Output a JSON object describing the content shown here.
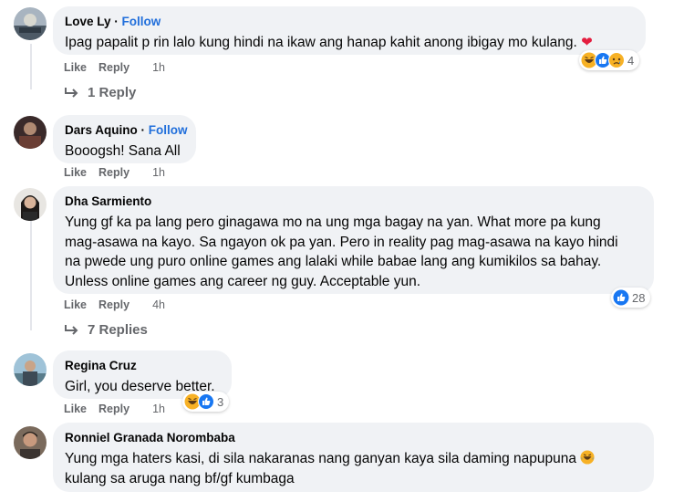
{
  "comments": [
    {
      "author": "Love Ly",
      "follow": "Follow",
      "text": "Ipag papalit p rin lalo kung hindi na ikaw ang hanap kahit anong ibigay mo kulang.",
      "like": "Like",
      "reply": "Reply",
      "time": "1h",
      "reaction_count": "4",
      "replies": "1 Reply"
    },
    {
      "author": "Dars Aquino",
      "follow": "Follow",
      "text": "Booogsh! Sana All",
      "like": "Like",
      "reply": "Reply",
      "time": "1h"
    },
    {
      "author": "Dha Sarmiento",
      "text_lines": [
        "Yung gf ka pa lang pero ginagawa mo na ung mga bagay na yan. What more pa kung",
        "mag-asawa na kayo. Sa ngayon ok pa yan. Pero in reality pag mag-asawa na kayo hindi",
        "na pwede ung puro online games ang lalaki while babae lang ang kumikilos sa bahay.",
        "Unless online games ang career ng guy. Acceptable yun."
      ],
      "like": "Like",
      "reply": "Reply",
      "time": "4h",
      "reaction_count": "28",
      "replies": "7 Replies"
    },
    {
      "author": "Regina Cruz",
      "text": "Girl, you deserve better.",
      "like": "Like",
      "reply": "Reply",
      "time": "1h",
      "reaction_count": "3"
    },
    {
      "author": "Ronniel Granada Norombaba",
      "text_lines": [
        "Yung mga haters kasi, di sila nakaranas nang ganyan kaya sila daming napupuna",
        "kulang sa aruga nang bf/gf kumbaga"
      ]
    }
  ],
  "colors": {
    "bubble": "#f0f2f5",
    "follow": "#216fdb",
    "meta": "#65676b",
    "like_reaction": "#1877f2",
    "haha_reaction": "#f7b125",
    "heart": "#e41e3f"
  },
  "icons": {
    "heart": "heart-emoji",
    "haha": "haha-reaction-icon",
    "like": "like-reaction-icon",
    "sad": "sad-reaction-icon",
    "reply_arrow": "reply-arrow-icon"
  }
}
